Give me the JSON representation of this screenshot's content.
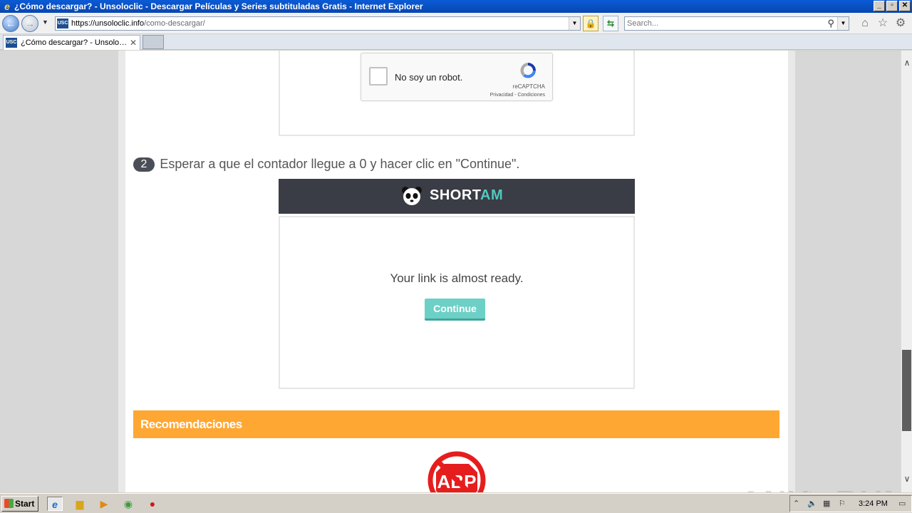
{
  "window": {
    "title": "¿Cómo descargar? - Unsoloclic - Descargar Películas y Series subtituladas Gratis - Internet Explorer",
    "controls": [
      "_",
      "▫",
      "✕"
    ]
  },
  "address_bar": {
    "favicon_text": "USC",
    "url_host": "https://unsoloclic.info",
    "url_path": "/como-descargar/"
  },
  "search": {
    "placeholder": "Search..."
  },
  "tab": {
    "label": "¿Cómo descargar? - Unsoloclic..."
  },
  "captcha": {
    "label": "No soy un robot.",
    "brand": "reCAPTCHA",
    "links": "Privacidad - Condiciones"
  },
  "step2": {
    "number": "2",
    "text": "Esperar a que el contador llegue a 0 y hacer clic en \"Continue\"."
  },
  "shortam": {
    "brand_a": "SHORT",
    "brand_b": "AM",
    "message": "Your link is almost ready.",
    "button": "Continue"
  },
  "recommendations": {
    "title": "Recomendaciones"
  },
  "watermark": "ANY▷RUN",
  "taskbar": {
    "start": "Start",
    "clock": "3:24 PM"
  },
  "colors": {
    "orange": "#ffa733",
    "teal": "#6dd0c6",
    "dark_header": "#3a3d45"
  }
}
